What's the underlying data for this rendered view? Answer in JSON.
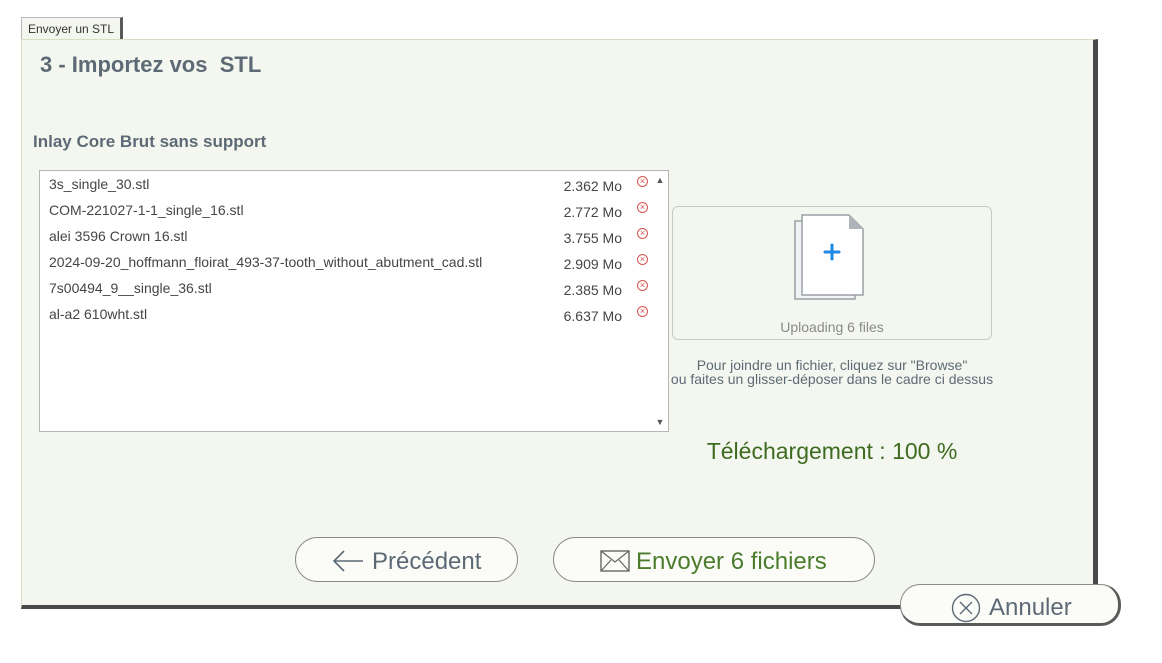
{
  "tab": {
    "label": "Envoyer un STL"
  },
  "step_title": "3 - Importez vos  STL",
  "product_title": "Inlay Core Brut sans support",
  "files": [
    {
      "name": "3s_single_30.stl",
      "size": "2.362 Mo"
    },
    {
      "name": "COM-221027-1-1_single_16.stl",
      "size": "2.772 Mo"
    },
    {
      "name": "alei 3596 Crown 16.stl",
      "size": "3.755 Mo"
    },
    {
      "name": "2024-09-20_hoffmann_floirat_493-37-tooth_without_abutment_cad.stl",
      "size": "2.909 Mo"
    },
    {
      "name": "7s00494_9__single_36.stl",
      "size": "2.385 Mo"
    },
    {
      "name": "al-a2 610wht.stl",
      "size": "6.637 Mo"
    }
  ],
  "icons": {
    "remove": "remove-circle-x-icon",
    "scroll_up": "triangle-up-icon",
    "scroll_down": "triangle-down-icon",
    "add_file": "document-plus-icon",
    "prev": "arrow-left-icon",
    "send": "envelope-icon",
    "cancel": "circle-x-icon"
  },
  "dropzone": {
    "status": "Uploading 6 files"
  },
  "hint": {
    "line1": "Pour joindre un fichier, cliquez sur \"Browse\"",
    "line2": "ou faites un glisser-déposer dans le cadre ci dessus"
  },
  "progress": {
    "label": "Téléchargement : 100 %",
    "value": 100
  },
  "buttons": {
    "prev": "Précédent",
    "send": "Envoyer 6 fichiers",
    "cancel": "Annuler"
  },
  "colors": {
    "panel_bg": "#f4f7ef",
    "title_text": "#5d6a76",
    "progress_text": "#3e6b1f",
    "send_text": "#4b7c2c",
    "remove_icon": "#d9534f",
    "add_icon": "#1e88e5"
  }
}
